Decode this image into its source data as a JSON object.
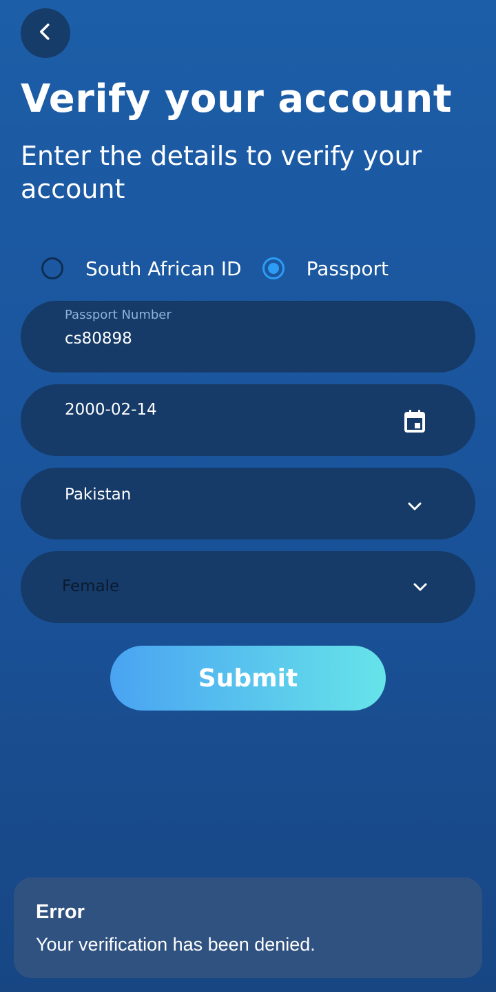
{
  "header": {
    "back_icon": "chevron-left-icon",
    "title": "Verify your account",
    "subtitle": "Enter the details to verify your account"
  },
  "id_type": {
    "options": [
      {
        "label": "South African ID",
        "selected": false
      },
      {
        "label": "Passport",
        "selected": true
      }
    ]
  },
  "form": {
    "passport": {
      "label": "Passport Number",
      "value": "cs80898"
    },
    "dob": {
      "value": "2000-02-14",
      "icon": "calendar-icon"
    },
    "country": {
      "value": "Pakistan",
      "icon": "chevron-down-icon"
    },
    "gender": {
      "value": "Female",
      "icon": "chevron-down-icon"
    },
    "submit_label": "Submit"
  },
  "toast": {
    "title": "Error",
    "message": "Your verification has been denied."
  },
  "colors": {
    "background_top": "#1c5ea8",
    "background_bottom": "#174683",
    "field_background": "#163b69",
    "radio_selected": "#2d9cf5",
    "submit_gradient_start": "#4aa3f2",
    "submit_gradient_end": "#66e4e9",
    "toast_background": "#305281"
  }
}
